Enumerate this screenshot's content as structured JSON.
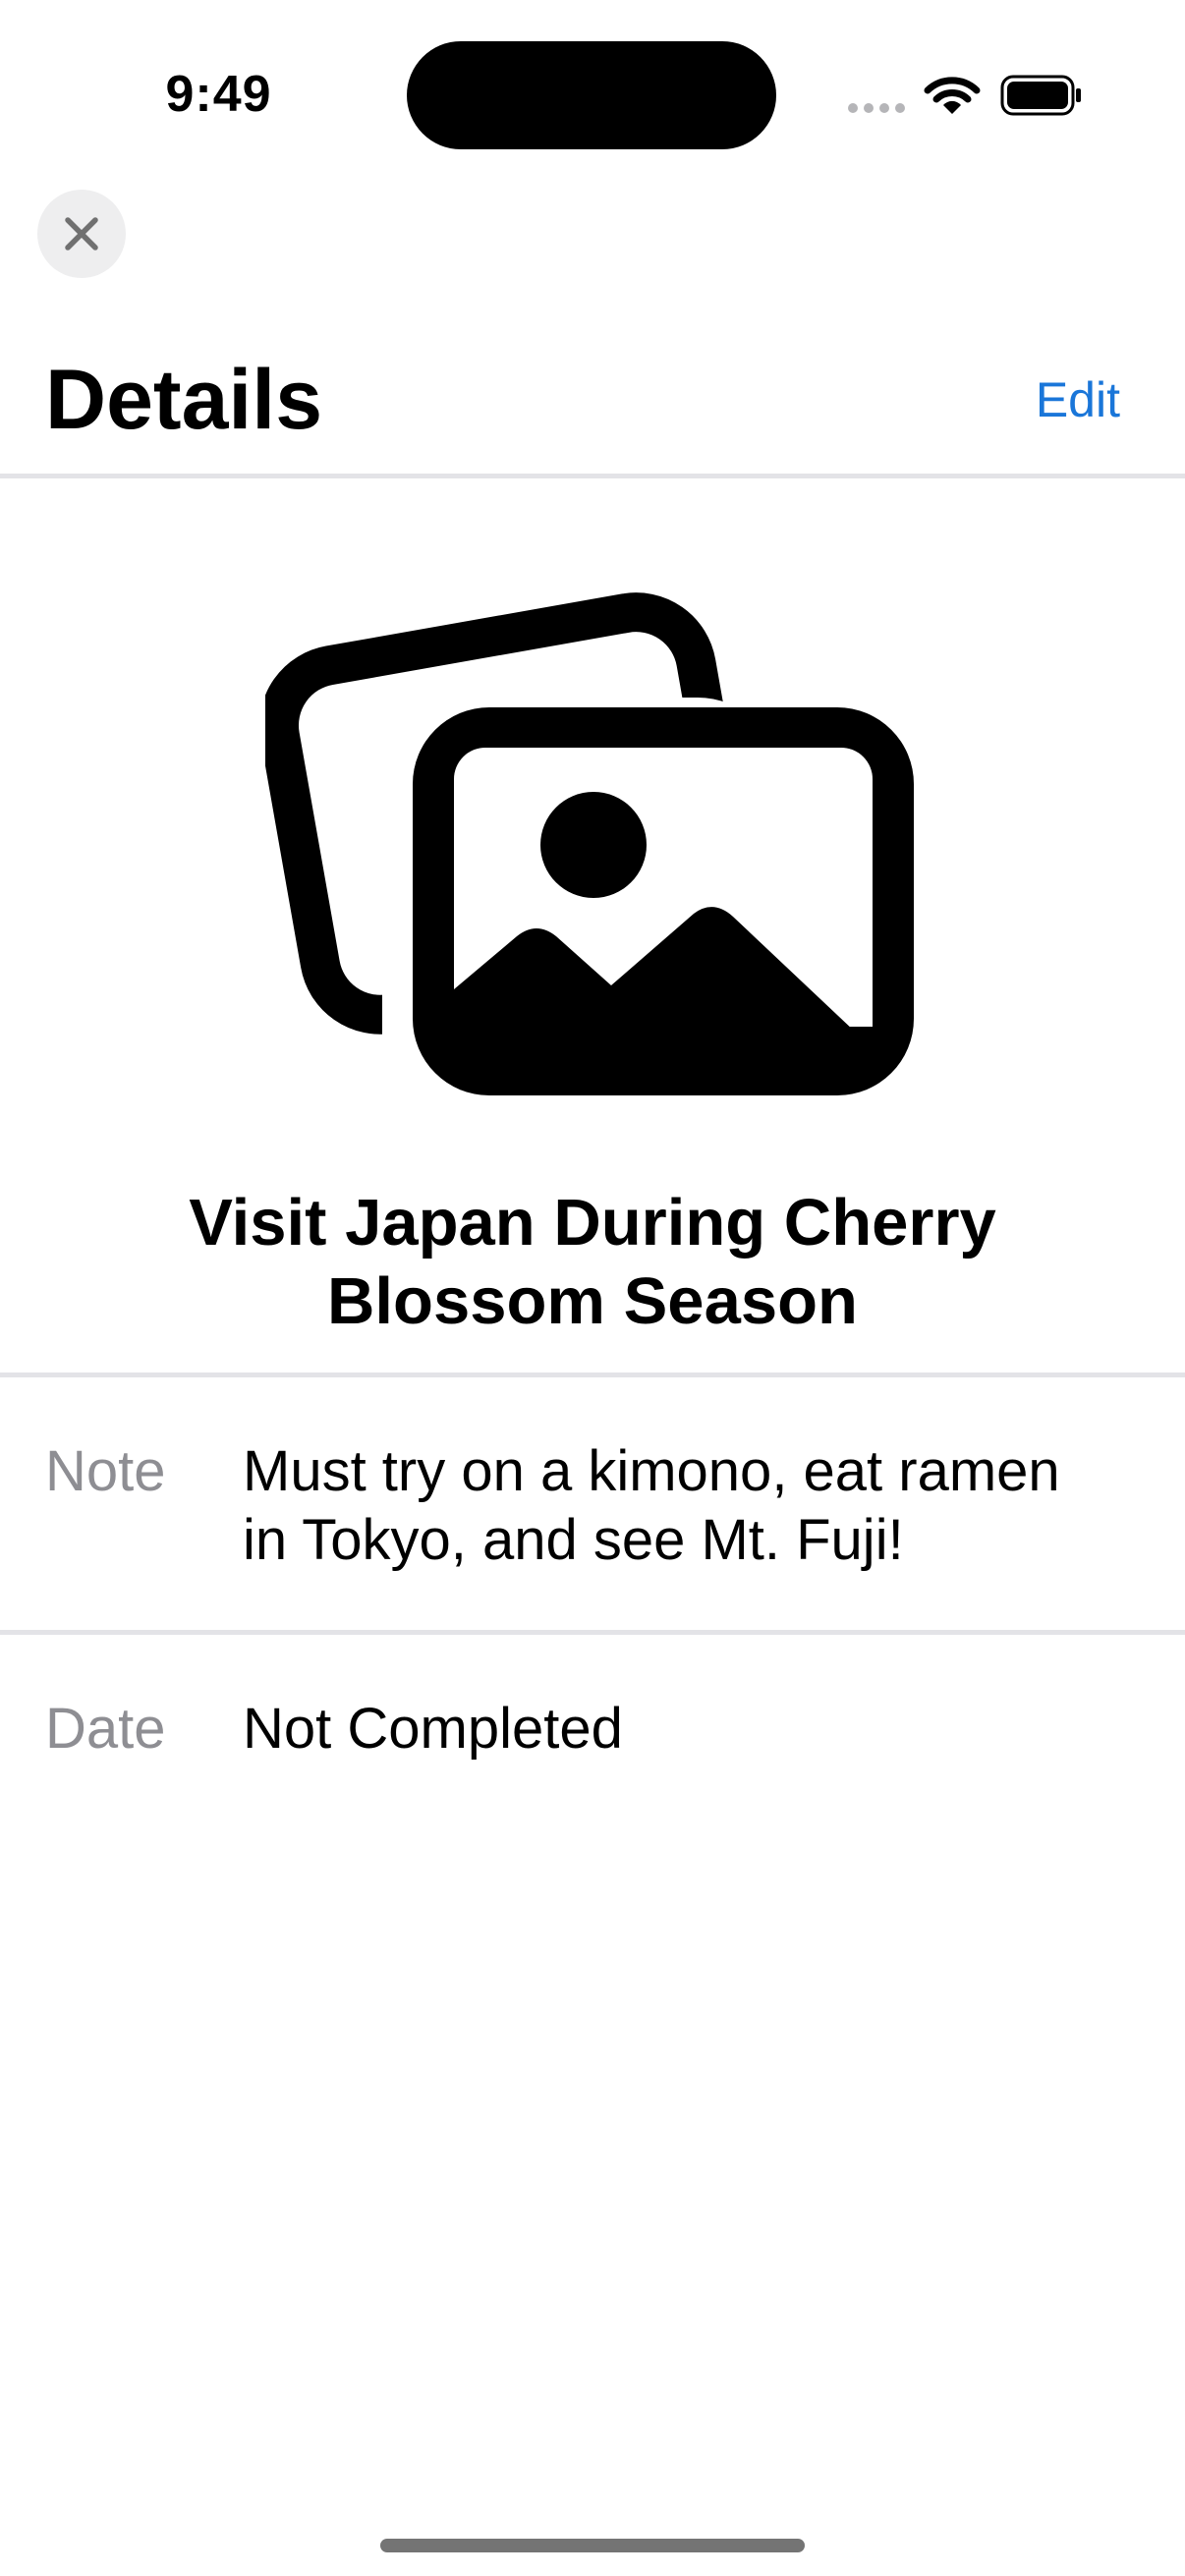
{
  "status_bar": {
    "time": "9:49",
    "icons": [
      "cellular-signal-icon",
      "wifi-icon",
      "battery-icon"
    ]
  },
  "nav": {
    "close_icon": "close-icon",
    "title": "Details",
    "edit_label": "Edit"
  },
  "item": {
    "image_icon": "photo-stack-icon",
    "title": "Visit Japan During Cherry Blossom Season"
  },
  "rows": [
    {
      "label": "Note",
      "value": "Must try on a kimono, eat ramen in Tokyo, and see Mt. Fuji!"
    },
    {
      "label": "Date",
      "value": "Not Completed"
    }
  ],
  "colors": {
    "accent": "#1a76d9",
    "secondary_text": "#8e8e93",
    "divider": "#e3e3e7"
  }
}
